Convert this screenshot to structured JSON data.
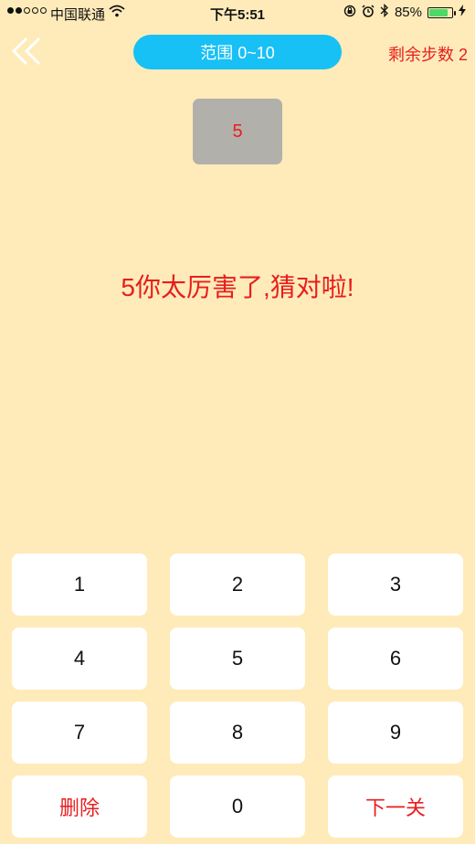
{
  "status_bar": {
    "carrier": "中国联通",
    "time": "下午5:51",
    "battery": "85%",
    "battery_level": 0.85
  },
  "header": {
    "range_label": "范围 0~10",
    "steps_label": "剩余步数 2"
  },
  "guess": {
    "value": "5"
  },
  "message": "5你太厉害了,猜对啦!",
  "keypad": {
    "k1": "1",
    "k2": "2",
    "k3": "3",
    "k4": "4",
    "k5": "5",
    "k6": "6",
    "k7": "7",
    "k8": "8",
    "k9": "9",
    "delete": "删除",
    "k0": "0",
    "next": "下一关"
  },
  "colors": {
    "background": "#FFEBB9",
    "accent_blue": "#17C0F5",
    "accent_red": "#E81E1E",
    "guess_box": "#B2B0AB"
  }
}
